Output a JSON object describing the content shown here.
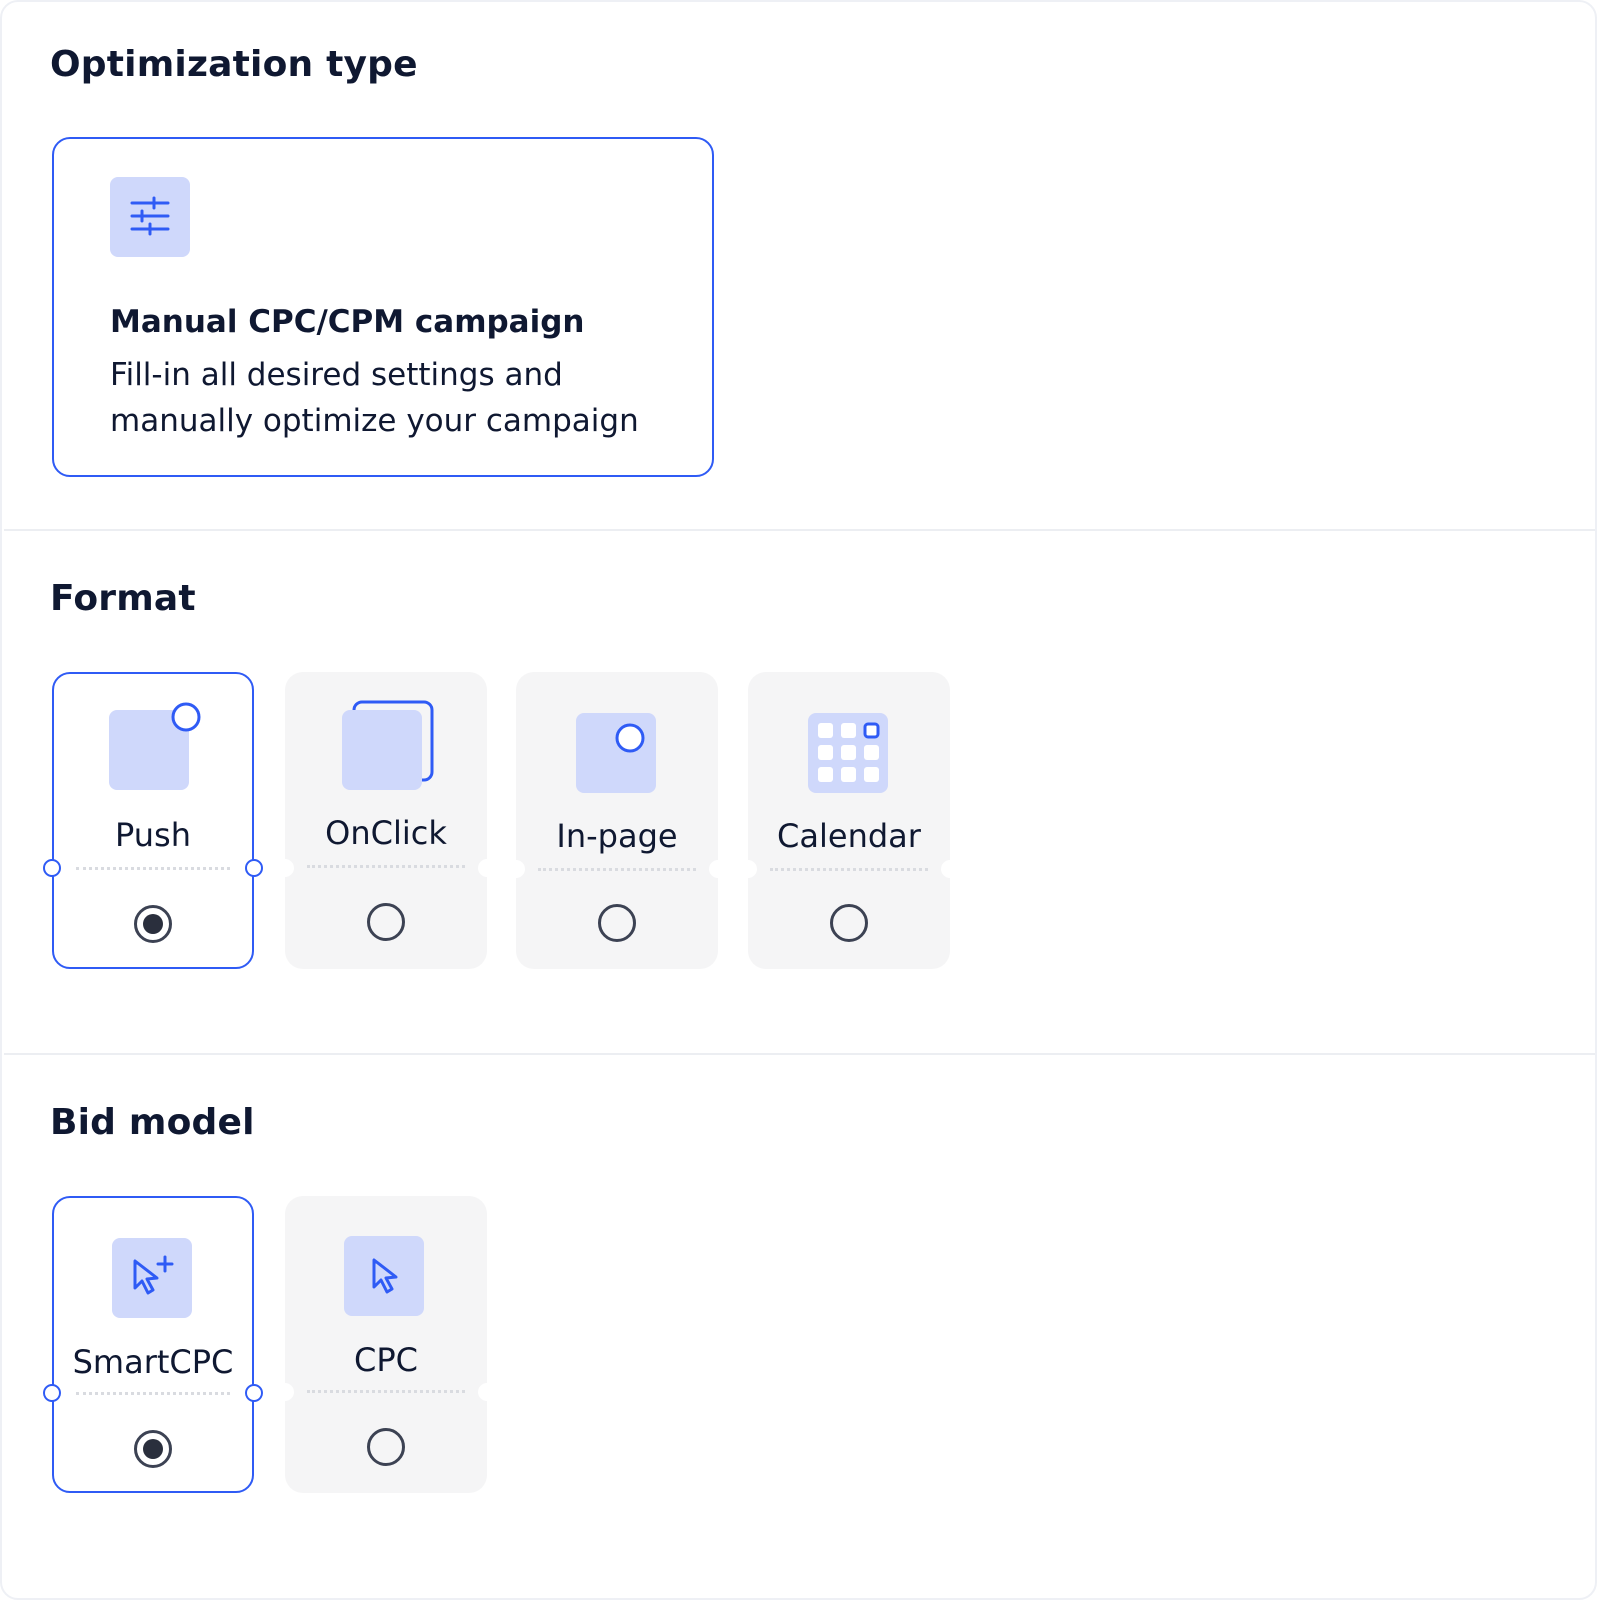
{
  "optimization": {
    "title": "Optimization type",
    "card": {
      "icon": "sliders-icon",
      "title": "Manual CPC/CPM campaign",
      "description": "Fill-in all desired settings and manually optimize your campaign",
      "selected": true
    }
  },
  "format": {
    "title": "Format",
    "options": [
      {
        "label": "Push",
        "icon": "push-icon",
        "selected": true
      },
      {
        "label": "OnClick",
        "icon": "onclick-icon",
        "selected": false
      },
      {
        "label": "In-page",
        "icon": "inpage-icon",
        "selected": false
      },
      {
        "label": "Calendar",
        "icon": "calendar-icon",
        "selected": false
      }
    ]
  },
  "bid_model": {
    "title": "Bid model",
    "options": [
      {
        "label": "SmartCPC",
        "icon": "cursor-plus-icon",
        "selected": true
      },
      {
        "label": "CPC",
        "icon": "cursor-icon",
        "selected": false
      }
    ]
  },
  "colors": {
    "accent": "#2f5bf5",
    "icon_bg": "#cfd8fb",
    "tile_bg": "#f5f5f6",
    "text": "#0f1831"
  }
}
